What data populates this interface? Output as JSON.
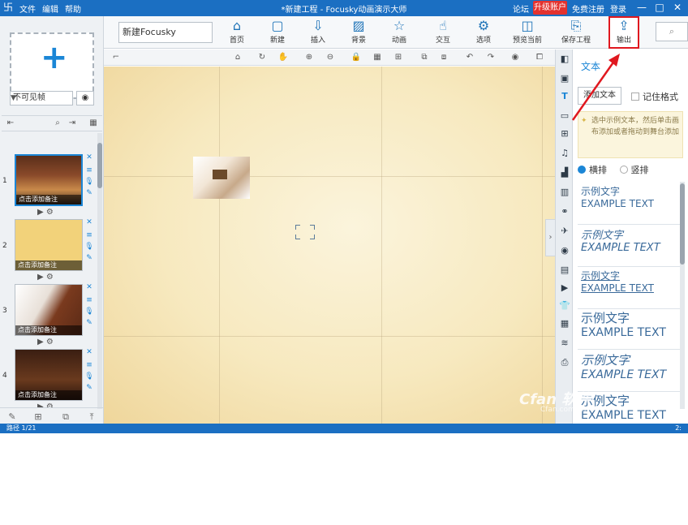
{
  "titlebar": {
    "menus": [
      "文件",
      "编辑",
      "帮助"
    ],
    "title": "*新建工程 - Focusky动画演示大师",
    "forum": "论坛",
    "upgrade": "升级账户",
    "free_register": "免费注册",
    "login": "登录",
    "win_min": "—",
    "win_max": "□",
    "win_close": "✕"
  },
  "left": {
    "frame_select": "不可见帧",
    "thumbs": [
      {
        "num": "1",
        "caption": "点击添加备注"
      },
      {
        "num": "2",
        "caption": "点击添加备注"
      },
      {
        "num": "3",
        "caption": "点击添加备注"
      },
      {
        "num": "4",
        "caption": "点击添加备注"
      }
    ]
  },
  "toolbar": {
    "project_name": "新建Focusky",
    "buttons": [
      {
        "icon": "home-icon",
        "label": "首页"
      },
      {
        "icon": "new-icon",
        "label": "新建"
      },
      {
        "icon": "insert-icon",
        "label": "插入"
      },
      {
        "icon": "background-icon",
        "label": "背景"
      },
      {
        "icon": "animation-icon",
        "label": "动画"
      },
      {
        "icon": "interaction-icon",
        "label": "交互"
      },
      {
        "icon": "options-icon",
        "label": "选项"
      },
      {
        "icon": "preview-icon",
        "label": "预览当前"
      },
      {
        "icon": "save-icon",
        "label": "保存工程"
      },
      {
        "icon": "export-icon",
        "label": "输出"
      }
    ]
  },
  "right": {
    "panel_title": "文本",
    "add_text": "添加文本",
    "remember_format": "记住格式",
    "hint": "选中示例文本，然后单击画布添加或者拖动到舞台添加",
    "horizontal": "横排",
    "vertical": "竖排",
    "samples": [
      {
        "line1": "示例文字",
        "line2": "EXAMPLE TEXT",
        "style": "small"
      },
      {
        "line1": "示例文字",
        "line2": "EXAMPLE TEXT",
        "style": "italic"
      },
      {
        "line1": "示例文字",
        "line2": "EXAMPLE TEXT",
        "style": "underline"
      },
      {
        "line1": "示例文字",
        "line2": "EXAMPLE TEXT",
        "style": "large"
      },
      {
        "line1": "示例文字",
        "line2": "EXAMPLE TEXT",
        "style": "large-italic"
      },
      {
        "line1": "示例文字",
        "line2": "EXAMPLE TEXT",
        "style": "plain"
      }
    ]
  },
  "status": {
    "path": "路径 1/21",
    "zoom": "2:"
  },
  "watermark": {
    "main": "Cfan 软件",
    "sub": "Cfan.com.cn"
  },
  "colors": {
    "accent": "#1b6fc2",
    "upgrade": "#e3322f",
    "highlight": "#e0181f"
  }
}
